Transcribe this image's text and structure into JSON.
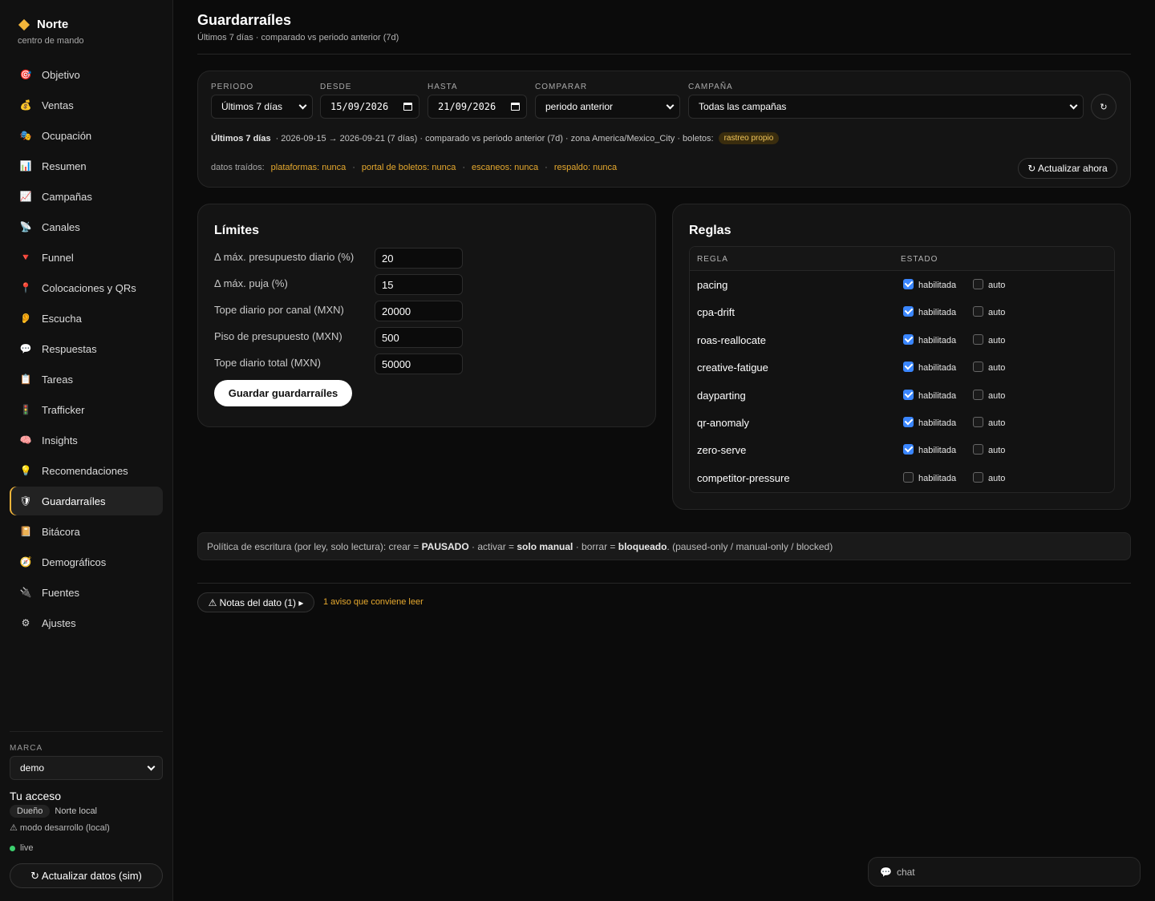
{
  "brand": {
    "name": "Norte",
    "subtitle": "centro de mando"
  },
  "nav": [
    {
      "label": "Objetivo",
      "icon": "🎯"
    },
    {
      "label": "Ventas",
      "icon": "💰"
    },
    {
      "label": "Ocupación",
      "icon": "🎭"
    },
    {
      "label": "Resumen",
      "icon": "📊"
    },
    {
      "label": "Campañas",
      "icon": "📈"
    },
    {
      "label": "Canales",
      "icon": "📡"
    },
    {
      "label": "Funnel",
      "icon": "🔻"
    },
    {
      "label": "Colocaciones y QRs",
      "icon": "📍"
    },
    {
      "label": "Escucha",
      "icon": "👂"
    },
    {
      "label": "Respuestas",
      "icon": "💬"
    },
    {
      "label": "Tareas",
      "icon": "📋"
    },
    {
      "label": "Trafficker",
      "icon": "🚦"
    },
    {
      "label": "Insights",
      "icon": "🧠"
    },
    {
      "label": "Recomendaciones",
      "icon": "💡"
    },
    {
      "label": "Guardarraíles",
      "icon": "🛡"
    },
    {
      "label": "Bitácora",
      "icon": "📔"
    },
    {
      "label": "Demográficos",
      "icon": "🧭"
    },
    {
      "label": "Fuentes",
      "icon": "🔌"
    },
    {
      "label": "Ajustes",
      "icon": "⚙"
    }
  ],
  "sidebar_bottom": {
    "marca_label": "MARCA",
    "marca_value": "demo",
    "acceso_title": "Tu acceso",
    "role": "Dueño",
    "org": "Norte local",
    "dev_mode": "⚠ modo desarrollo (local)",
    "live": "live",
    "refresh_label": "↻ Actualizar datos (sim)"
  },
  "header": {
    "title": "Guardarraíles",
    "subtitle": "Últimos 7 días · comparado vs periodo anterior (7d)"
  },
  "filters": {
    "periodo_label": "PERIODO",
    "periodo_value": "Últimos 7 días",
    "desde_label": "DESDE",
    "desde_value": "15/09/2026",
    "hasta_label": "HASTA",
    "hasta_value": "21/09/2026",
    "comparar_label": "COMPARAR",
    "comparar_value": "periodo anterior",
    "campana_label": "CAMPAÑA",
    "campana_value": "Todas las campañas",
    "refresh_icon": "↻",
    "summary_bold": "Últimos 7 días",
    "summary_text": "· 2026-09-15 → 2026-09-21 (7 días) · comparado vs periodo anterior (7d) · zona America/Mexico_City · boletos:",
    "summary_tag": "rastreo propio",
    "sources_label": "datos traídos:",
    "sources": [
      "plataformas: nunca",
      "portal de boletos: nunca",
      "escaneos: nunca",
      "respaldo: nunca"
    ],
    "sources_sep": "·",
    "update_label": "↻ Actualizar ahora"
  },
  "limits": {
    "title": "Límites",
    "fields": [
      {
        "label": "Δ máx. presupuesto diario (%)",
        "value": "20"
      },
      {
        "label": "Δ máx. puja (%)",
        "value": "15"
      },
      {
        "label": "Tope diario por canal (MXN)",
        "value": "20000"
      },
      {
        "label": "Piso de presupuesto (MXN)",
        "value": "500"
      },
      {
        "label": "Tope diario total (MXN)",
        "value": "50000"
      }
    ],
    "save_label": "Guardar guardarraíles"
  },
  "rules": {
    "title": "Reglas",
    "col_rule": "REGLA",
    "col_state": "ESTADO",
    "enabled_label": "habilitada",
    "auto_label": "auto",
    "rows": [
      {
        "name": "pacing",
        "enabled": true,
        "auto": false
      },
      {
        "name": "cpa-drift",
        "enabled": true,
        "auto": false
      },
      {
        "name": "roas-reallocate",
        "enabled": true,
        "auto": false
      },
      {
        "name": "creative-fatigue",
        "enabled": true,
        "auto": false
      },
      {
        "name": "dayparting",
        "enabled": true,
        "auto": false
      },
      {
        "name": "qr-anomaly",
        "enabled": true,
        "auto": false
      },
      {
        "name": "zero-serve",
        "enabled": true,
        "auto": false
      },
      {
        "name": "competitor-pressure",
        "enabled": false,
        "auto": false
      }
    ]
  },
  "policy": {
    "t1": "Política de escritura (por ley, solo lectura): crear = ",
    "b1": "PAUSADO",
    "t2": " · activar = ",
    "b2": "solo manual",
    "t3": " · borrar = ",
    "b3": "bloqueado",
    "t4": ". (paused-only / manual-only / blocked)"
  },
  "notes": {
    "label": "⚠ Notas del dato (1) ▸",
    "warning": "1 aviso que conviene leer"
  },
  "chat": {
    "icon": "💬",
    "label": "chat"
  }
}
